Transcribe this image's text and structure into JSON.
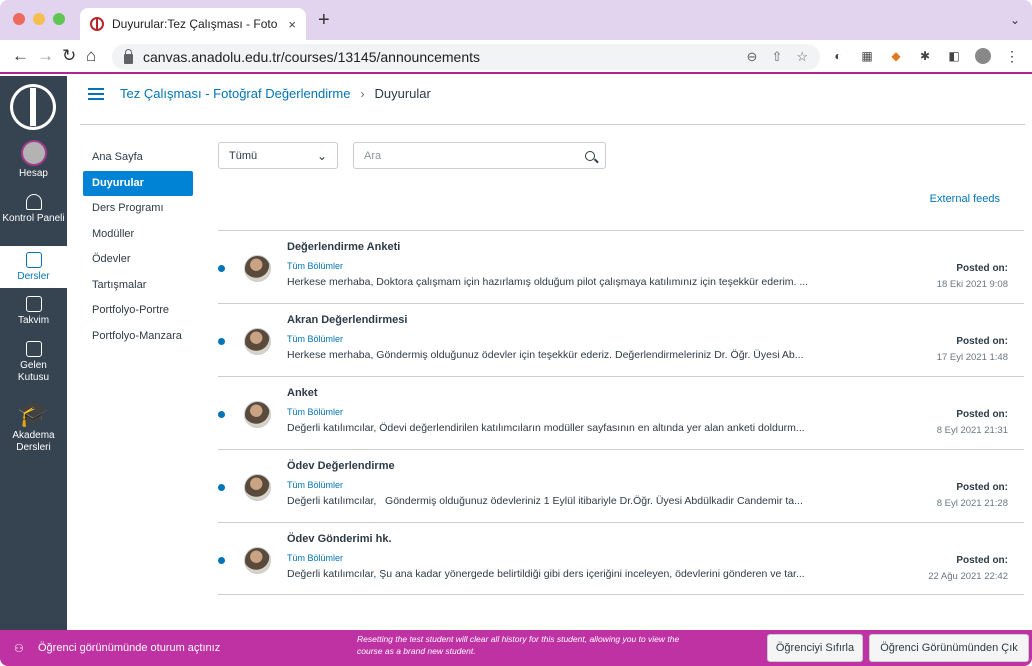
{
  "browser": {
    "tab_title": "Duyurular:Tez Çalışması - Foto",
    "tab_close": "×",
    "new_tab": "+",
    "url": "canvas.anadolu.edu.tr/courses/13145/announcements"
  },
  "global_nav": {
    "items": [
      {
        "label": "Hesap",
        "icon": "account-avatar"
      },
      {
        "label": "Kontrol Paneli",
        "icon": "dashboard-icon"
      },
      {
        "label": "Dersler",
        "icon": "courses-icon",
        "active": true
      },
      {
        "label": "Takvim",
        "icon": "calendar-icon"
      },
      {
        "label": "Gelen Kutusu",
        "icon": "inbox-icon"
      },
      {
        "label": "Akadema Dersleri",
        "icon": "graduation-cap-icon"
      }
    ]
  },
  "breadcrumb": {
    "course": "Tez Çalışması - Fotoğraf Değerlendirme",
    "separator": "›",
    "current": "Duyurular"
  },
  "course_nav": {
    "items": [
      "Ana Sayfa",
      "Duyurular",
      "Ders Programı",
      "Modüller",
      "Ödevler",
      "Tartışmalar",
      "Portfolyo-Portre",
      "Portfolyo-Manzara"
    ],
    "active_index": 1
  },
  "filters": {
    "section_select": "Tümü",
    "search_placeholder": "Ara",
    "external_feeds": "External feeds"
  },
  "announcements": [
    {
      "title": "Değerlendirme Anketi",
      "sections": "Tüm Bölümler",
      "message": "Herkese merhaba, Doktora çalışmam için hazırlamış olduğum pilot çalışmaya katılımınız için teşekkür ederim. ...",
      "posted_label": "Posted on:",
      "posted_date": "18 Eki 2021 9:08"
    },
    {
      "title": "Akran Değerlendirmesi",
      "sections": "Tüm Bölümler",
      "message": "Herkese merhaba, Göndermiş olduğunuz ödevler için teşekkür ederiz. Değerlendirmeleriniz Dr. Öğr. Üyesi Ab...",
      "posted_label": "Posted on:",
      "posted_date": "17 Eyl 2021 1:48"
    },
    {
      "title": "Anket",
      "sections": "Tüm Bölümler",
      "message": "Değerli katılımcılar, Ödevi değerlendirilen katılımcıların modüller sayfasının en altında yer alan anketi doldurm...",
      "posted_label": "Posted on:",
      "posted_date": "8 Eyl 2021 21:31"
    },
    {
      "title": "Ödev Değerlendirme",
      "sections": "Tüm Bölümler",
      "message": "Değerli katılımcılar,   Göndermiş olduğunuz ödevleriniz 1 Eylül itibariyle Dr.Öğr. Üyesi Abdülkadir Candemir ta...",
      "posted_label": "Posted on:",
      "posted_date": "8 Eyl 2021 21:28"
    },
    {
      "title": "Ödev Gönderimi hk.",
      "sections": "Tüm Bölümler",
      "message": "Değerli katılımcılar, Şu ana kadar yönergede belirtildiği gibi ders içeriğini inceleyen, ödevlerini gönderen ve tar...",
      "posted_label": "Posted on:",
      "posted_date": "22 Ağu 2021 22:42"
    }
  ],
  "student_view": {
    "label": "Öğrenci görünümünde oturum açtınız",
    "note": "Resetting the test student will clear all history for this student, allowing you to view the course as a brand new student.",
    "reset_button": "Öğrenciyi Sıfırla",
    "leave_button": "Öğrenci Görünümünden Çık"
  },
  "colors": {
    "brand_purple": "#bf32a4",
    "link_blue": "#0374b5",
    "sidebar_dark": "#364350",
    "active_nav": "#0083d5"
  }
}
